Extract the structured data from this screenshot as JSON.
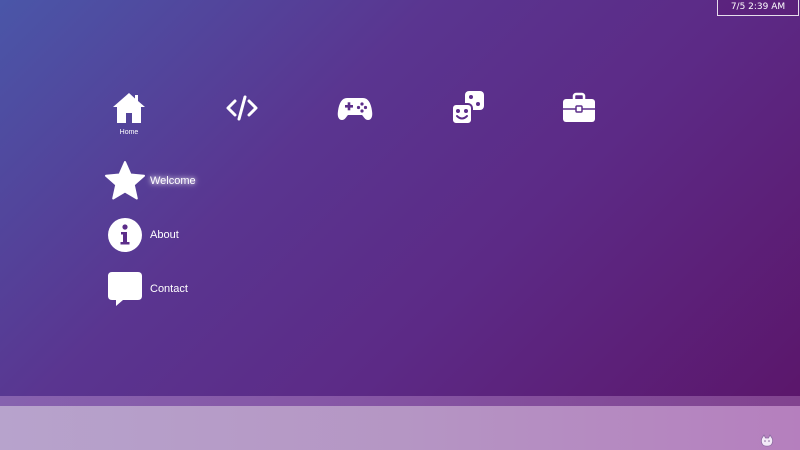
{
  "clock": {
    "text": "7/5 2:39 AM"
  },
  "top_icons": [
    {
      "name": "home-icon",
      "label": "Home"
    },
    {
      "name": "code-icon",
      "label": ""
    },
    {
      "name": "gamepad-icon",
      "label": ""
    },
    {
      "name": "dice-icon",
      "label": ""
    },
    {
      "name": "briefcase-icon",
      "label": ""
    }
  ],
  "side_menu": {
    "items": [
      {
        "icon": "star-icon",
        "label": "Welcome",
        "active": true
      },
      {
        "icon": "info-icon",
        "label": "About",
        "active": false
      },
      {
        "icon": "chat-bubble-icon",
        "label": "Contact",
        "active": false
      }
    ]
  },
  "tray": {
    "icon": "cat-icon"
  },
  "colors": {
    "background_start": "#4a56a8",
    "background_end": "#5b1468",
    "taskbar": "#b596c4",
    "foreground": "#ffffff"
  }
}
